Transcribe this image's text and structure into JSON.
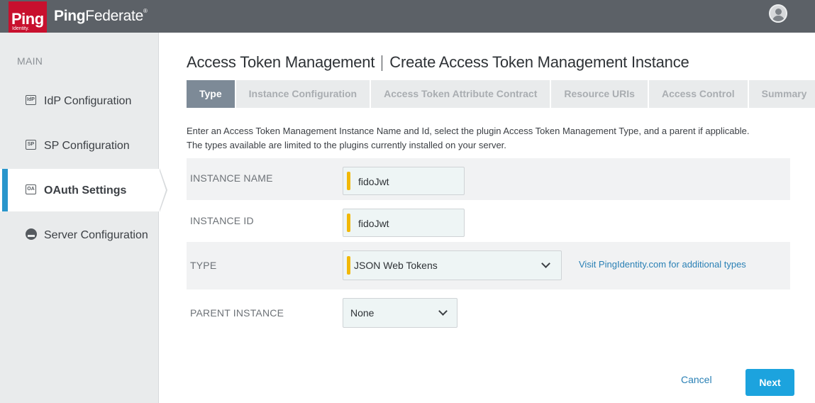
{
  "header": {
    "logo_text": "Ping",
    "logo_sub": "Identity.",
    "product_name_bold": "Ping",
    "product_name_rest": "Federate",
    "product_reg": "®",
    "icons": {
      "user": "user-avatar-icon"
    }
  },
  "sidebar": {
    "heading": "MAIN",
    "items": [
      {
        "label": "IdP Configuration",
        "icon": "IdP",
        "active": false
      },
      {
        "label": "SP Configuration",
        "icon": "SP",
        "active": false
      },
      {
        "label": "OAuth Settings",
        "icon": "OA",
        "active": true
      },
      {
        "label": "Server Configuration",
        "icon": "server-icon",
        "active": false
      }
    ]
  },
  "main": {
    "title_section": "Access Token Management",
    "title_page": "Create Access Token Management Instance",
    "tabs": [
      {
        "label": "Type",
        "active": true
      },
      {
        "label": "Instance Configuration",
        "active": false
      },
      {
        "label": "Access Token Attribute Contract",
        "active": false
      },
      {
        "label": "Resource URIs",
        "active": false
      },
      {
        "label": "Access Control",
        "active": false
      },
      {
        "label": "Summary",
        "active": false
      }
    ],
    "description_line1": "Enter an Access Token Management Instance Name and Id, select the plugin Access Token Management Type, and a parent if applicable.",
    "description_line2": "The types available are limited to the plugins currently installed on your server.",
    "form": {
      "instance_name_label": "INSTANCE NAME",
      "instance_name_value": "fidoJwt",
      "instance_id_label": "INSTANCE ID",
      "instance_id_value": "fidoJwt",
      "type_label": "TYPE",
      "type_value": "JSON Web Tokens",
      "type_link": "Visit PingIdentity.com for additional types",
      "parent_label": "PARENT INSTANCE",
      "parent_value": "None"
    },
    "actions": {
      "cancel": "Cancel",
      "next": "Next"
    }
  },
  "colors": {
    "accent": "#1ca3de",
    "active_nav": "#2996cc",
    "required": "#f2b807",
    "brand": "#c8102e"
  }
}
